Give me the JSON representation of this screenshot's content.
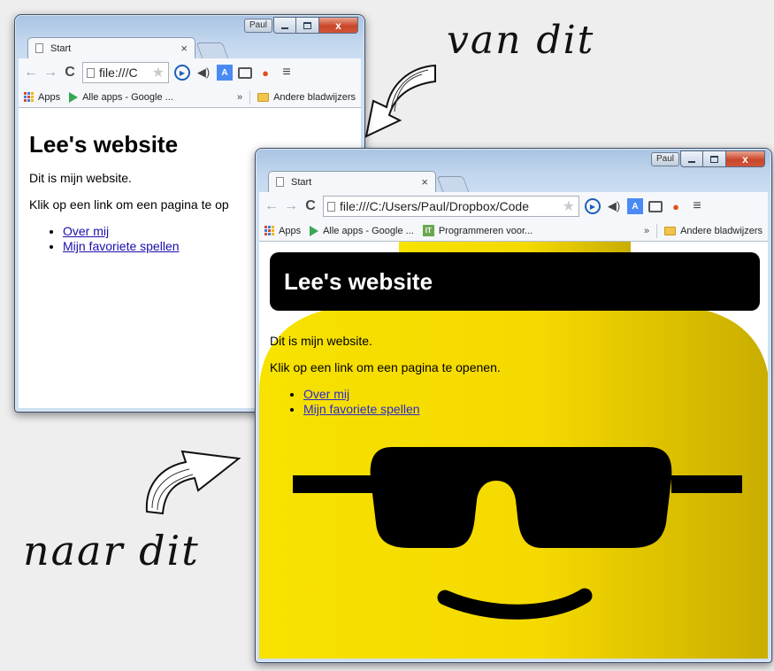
{
  "annotations": {
    "top_label": "van dit",
    "bottom_label": "naar dit"
  },
  "window_before": {
    "user_badge": "Paul",
    "tab_title": "Start",
    "tab_close": "×",
    "url": "file:///C",
    "bookmarks": {
      "apps": "Apps",
      "item1": "Alle apps - Google ...",
      "overflow": "»",
      "other": "Andere bladwijzers"
    },
    "page": {
      "heading": "Lee's website",
      "para1": "Dit is mijn website.",
      "para2": "Klik op een link om een pagina te op",
      "links": [
        "Over mij",
        "Mijn favoriete spellen"
      ]
    }
  },
  "window_after": {
    "user_badge": "Paul",
    "tab_title": "Start",
    "tab_close": "×",
    "url": "file:///C:/Users/Paul/Dropbox/Code",
    "bookmarks": {
      "apps": "Apps",
      "item1": "Alle apps - Google ...",
      "item2": "Programmeren voor...",
      "overflow": "»",
      "other": "Andere bladwijzers"
    },
    "page": {
      "heading": "Lee's website",
      "para1": "Dit is mijn website.",
      "para2": "Klik op een link om een pagina te openen.",
      "links": [
        "Over mij",
        "Mijn favoriete spellen"
      ]
    }
  },
  "icons": {
    "back": "←",
    "forward": "→",
    "reload": "C",
    "star": "★",
    "menu": "≡",
    "close": "x"
  },
  "colors": {
    "lego_yellow": "#f7d800",
    "link": "#1a0dab",
    "header_bar": "#000000"
  }
}
